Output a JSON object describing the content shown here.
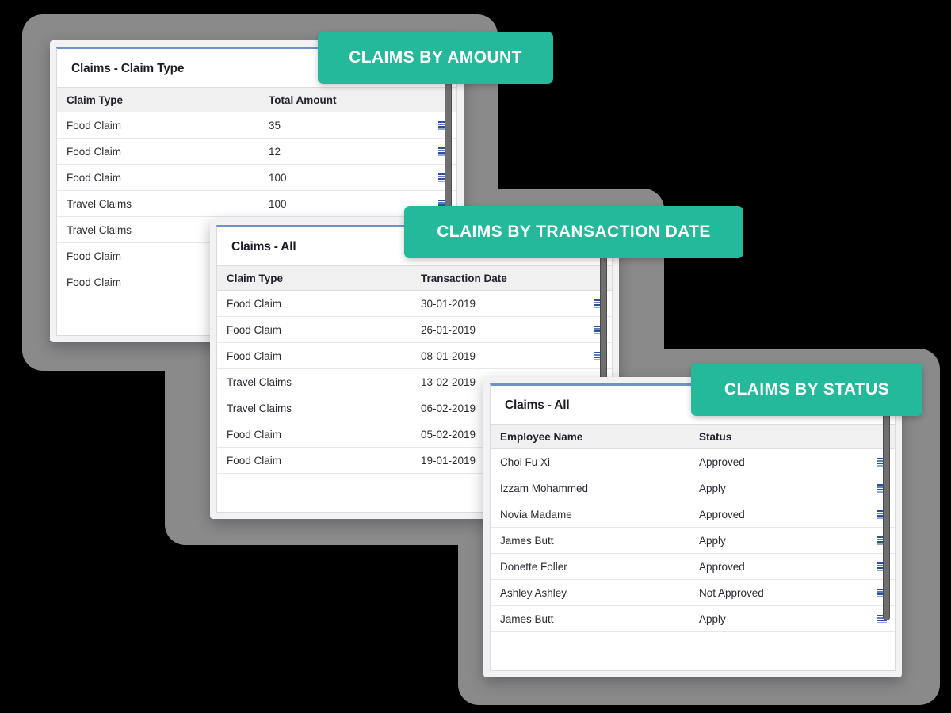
{
  "background": {
    "page_color": "#000000",
    "shadow_color": "#8a8a8a"
  },
  "theme": {
    "badge_color": "#23b99a",
    "badge_text_color": "#ffffff",
    "panel_accent_color": "#6e93c8",
    "header_bg_color": "#f0f0f0",
    "row_icon_color": "#2d4f9e"
  },
  "badges": [
    {
      "id": "claims-by-amount",
      "label": "CLAIMS BY AMOUNT"
    },
    {
      "id": "claims-by-transaction-date",
      "label": "CLAIMS BY TRANSACTION DATE"
    },
    {
      "id": "claims-by-status",
      "label": "CLAIMS BY STATUS"
    }
  ],
  "panels": [
    {
      "id": "claims-claim-type",
      "title": "Claims - Claim Type",
      "columns": [
        "Claim Type",
        "Total Amount"
      ],
      "rows": [
        {
          "col1": "Food Claim",
          "col2": "35"
        },
        {
          "col1": "Food Claim",
          "col2": "12"
        },
        {
          "col1": "Food Claim",
          "col2": "100"
        },
        {
          "col1": "Travel Claims",
          "col2": "100"
        },
        {
          "col1": "Travel Claims",
          "col2": ""
        },
        {
          "col1": "Food Claim",
          "col2": ""
        },
        {
          "col1": "Food Claim",
          "col2": ""
        }
      ],
      "row_icon": "list-rows-icon",
      "scrollbar": "vertical-scrollbar"
    },
    {
      "id": "claims-all-transaction-date",
      "title": "Claims - All",
      "columns": [
        "Claim Type",
        "Transaction Date"
      ],
      "rows": [
        {
          "col1": "Food Claim",
          "col2": "30-01-2019"
        },
        {
          "col1": "Food Claim",
          "col2": "26-01-2019"
        },
        {
          "col1": "Food Claim",
          "col2": "08-01-2019"
        },
        {
          "col1": "Travel Claims",
          "col2": "13-02-2019"
        },
        {
          "col1": "Travel Claims",
          "col2": "06-02-2019"
        },
        {
          "col1": "Food Claim",
          "col2": "05-02-2019"
        },
        {
          "col1": "Food Claim",
          "col2": "19-01-2019"
        }
      ],
      "row_icon": "list-rows-icon",
      "scrollbar": "vertical-scrollbar"
    },
    {
      "id": "claims-all-status",
      "title": "Claims - All",
      "columns": [
        "Employee Name",
        "Status"
      ],
      "rows": [
        {
          "col1": "Choi Fu Xi",
          "col2": "Approved"
        },
        {
          "col1": "Izzam Mohammed",
          "col2": "Apply"
        },
        {
          "col1": "Novia Madame",
          "col2": "Approved"
        },
        {
          "col1": "James Butt",
          "col2": "Apply"
        },
        {
          "col1": "Donette Foller",
          "col2": "Approved"
        },
        {
          "col1": "Ashley Ashley",
          "col2": "Not Approved"
        },
        {
          "col1": "James Butt",
          "col2": "Apply"
        }
      ],
      "row_icon": "list-rows-icon",
      "scrollbar": "vertical-scrollbar"
    }
  ]
}
